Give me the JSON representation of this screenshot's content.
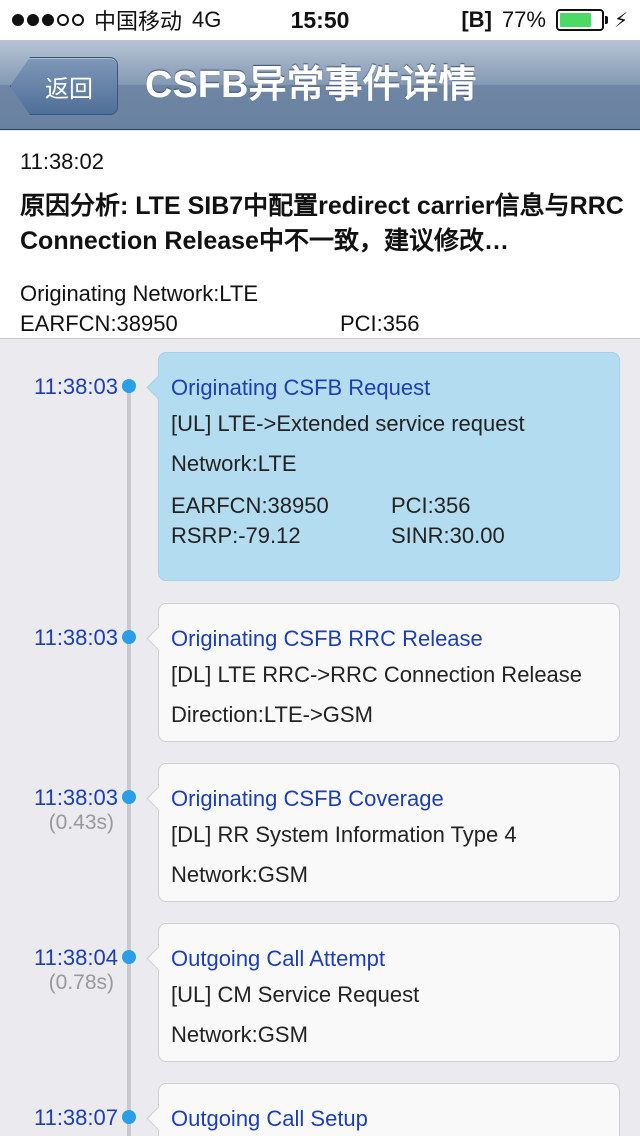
{
  "status_bar": {
    "carrier": "中国移动",
    "network": "4G",
    "time": "15:50",
    "b_icon": "[B]",
    "battery": "77%",
    "signal_bars": 3
  },
  "nav": {
    "back_label": "返回",
    "title": "CSFB异常事件详情"
  },
  "summary": {
    "time": "11:38:02",
    "cause": "原因分析: LTE SIB7中配置redirect carrier信息与RRC Connection Release中不一致，建议修改…",
    "originating_network": "Originating Network:LTE",
    "earfcn": "EARFCN:38950",
    "pci": "PCI:356"
  },
  "events": [
    {
      "time": "11:38:03",
      "delta": "",
      "title": "Originating CSFB Request",
      "message": "[UL] LTE->Extended service request",
      "detail": "Network:LTE",
      "kv": [
        [
          "EARFCN:38950",
          "PCI:356"
        ],
        [
          "RSRP:-79.12",
          "SINR:30.00"
        ]
      ],
      "selected": true
    },
    {
      "time": "11:38:03",
      "delta": "",
      "title": "Originating CSFB RRC Release",
      "message": "[DL] LTE RRC->RRC Connection Release",
      "detail": "Direction:LTE->GSM",
      "selected": false
    },
    {
      "time": "11:38:03",
      "delta": "(0.43s)",
      "title": "Originating CSFB Coverage",
      "message": "[DL] RR System Information Type 4",
      "detail": "Network:GSM",
      "selected": false
    },
    {
      "time": "11:38:04",
      "delta": "(0.78s)",
      "title": "Outgoing Call Attempt",
      "message": "[UL] CM Service Request",
      "detail": "Network:GSM",
      "selected": false
    },
    {
      "time": "11:38:07",
      "delta": "",
      "title": "Outgoing Call Setup",
      "message": "",
      "detail": "",
      "selected": false
    }
  ],
  "colors": {
    "selected_card": "#b4dcf0",
    "link_blue": "#1b3fb3",
    "dot_blue": "#2a9ee6",
    "battery_green": "#4cd964"
  }
}
